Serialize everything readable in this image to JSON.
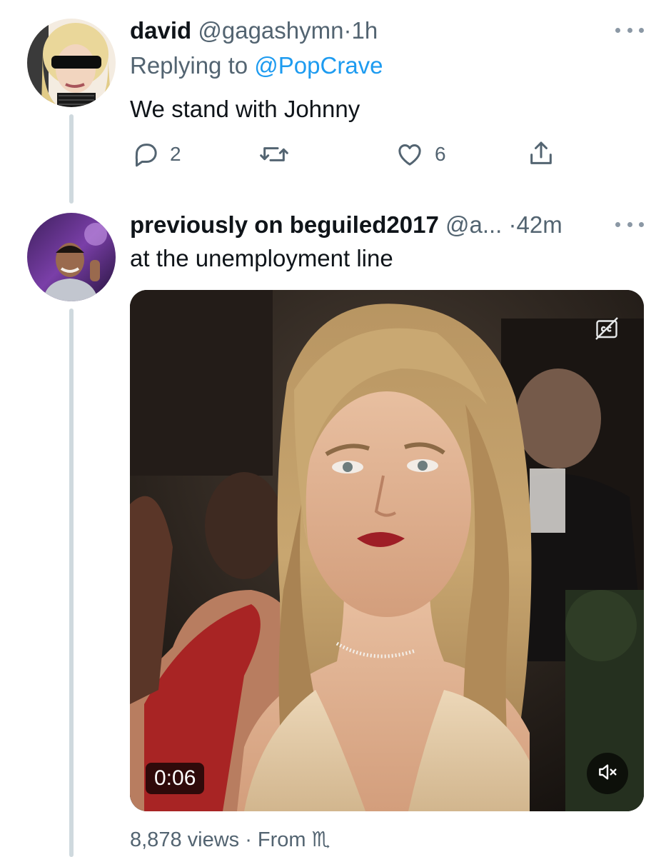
{
  "tweets": [
    {
      "display_name": "david",
      "handle": "@gagashymn",
      "separator": "·",
      "time": "1h",
      "reply_prefix": "Replying to",
      "reply_mention": "@PopCrave",
      "text": "We stand with Johnny",
      "replies": "2",
      "retweets": "",
      "likes": "6"
    },
    {
      "display_name": "previously on beguiled2017",
      "handle": "@a...",
      "separator": "·",
      "time": "42m",
      "text": "at the unemployment line",
      "video": {
        "duration": "0:06",
        "muted": true,
        "captions_icon": "closed-captions-off-icon"
      },
      "views": "8,878 views",
      "from_prefix": "· From",
      "from_glyph": "♏"
    }
  ],
  "icons": {
    "reply": "reply-icon",
    "retweet": "retweet-icon",
    "like": "heart-icon",
    "share": "share-icon",
    "more": "more-icon",
    "mute": "muted-speaker-icon"
  },
  "colors": {
    "link": "#1d9bf0",
    "secondary": "#536471",
    "primary_text": "#0f1419",
    "thread_line": "#cfd9de"
  }
}
